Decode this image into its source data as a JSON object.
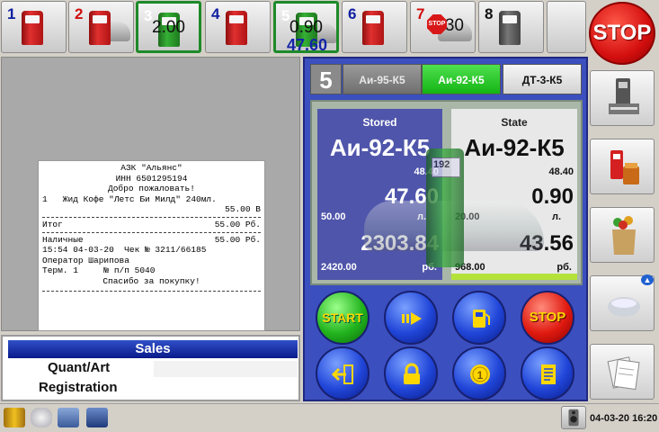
{
  "pumps": [
    {
      "num": "1",
      "num_color": "blue",
      "icon": "fuel-pump-red",
      "volume": "",
      "amount": ""
    },
    {
      "num": "2",
      "num_color": "red",
      "icon": "fuel-pump-red-car",
      "volume": "",
      "amount": ""
    },
    {
      "num": "3",
      "num_color": "white",
      "icon": "fuel-pump-green",
      "volume": "2.00",
      "amount": ""
    },
    {
      "num": "4",
      "num_color": "blue",
      "icon": "fuel-pump-red",
      "volume": "",
      "amount": ""
    },
    {
      "num": "5",
      "num_color": "white",
      "icon": "fuel-pump-green-car",
      "volume": "0.90",
      "amount": "47.60"
    },
    {
      "num": "6",
      "num_color": "blue",
      "icon": "fuel-pump-red",
      "volume": "",
      "amount": ""
    },
    {
      "num": "7",
      "num_color": "red",
      "icon": "fuel-pump-stop-car",
      "volume": "0.30",
      "amount": ""
    },
    {
      "num": "8",
      "num_color": "black",
      "icon": "fuel-pump-gray",
      "volume": "",
      "amount": ""
    }
  ],
  "stop_main_label": "STOP",
  "right_buttons": [
    {
      "name": "cash-register-button",
      "icon": "cash-register-icon"
    },
    {
      "name": "shop-goods-button",
      "icon": "shopping-goods-icon"
    },
    {
      "name": "grocery-bag-button",
      "icon": "grocery-bag-icon"
    },
    {
      "name": "fuel-tank-button",
      "icon": "fuel-tank-icon"
    },
    {
      "name": "reports-button",
      "icon": "reports-icon"
    }
  ],
  "receipt": {
    "line1": "АЗК \"Альянс\"",
    "line2": "ИНН 6501295194",
    "line3": "Добро пожаловать!",
    "item": "1   Жид Кофе \"Летс Би Милд\" 240мл.",
    "item_price": "55.00 В",
    "total_label": "Итог",
    "total_value": "55.00 Рб.",
    "cash_label": "Наличные",
    "cash_value": "55.00 Рб.",
    "datetime_check": "15:54 04-03-20  Чек № 3211/66185",
    "operator": "Оператор Шарипова",
    "terminal": "Терм. 1     № п/п 5040",
    "thanks": "Спасибо за покупку!"
  },
  "sales": {
    "title": "Sales",
    "quant_label": "Quant/Art",
    "registration_label": "Registration"
  },
  "main_panel": {
    "pump_number": "5",
    "fuel_tabs": [
      "Аи-95-К5",
      "Аи-92-К5",
      "ДТ-3-К5"
    ],
    "active_tab": 1,
    "stored": {
      "title": "Stored",
      "fuel": "Аи-92-К5",
      "price": "48.40",
      "volume": "47.60",
      "volume_unit": "л.",
      "preset": "50.00",
      "amount": "2303.84",
      "amount_unit": "рб.",
      "total": "2420.00"
    },
    "state": {
      "title": "State",
      "fuel": "Аи-92-К5",
      "price": "48.40",
      "volume": "0.90",
      "volume_unit": "л.",
      "preset": "20.00",
      "amount": "43.56",
      "amount_unit": "рб.",
      "total": "968.00"
    },
    "display_pump_screen": "192",
    "buttons": {
      "start": "START",
      "stop": "STOP"
    }
  },
  "clock": "04-03-20 16:20",
  "colors": {
    "panel_blue": "#3b4fbf",
    "active_green": "#22c022",
    "stop_red": "#d81818"
  }
}
